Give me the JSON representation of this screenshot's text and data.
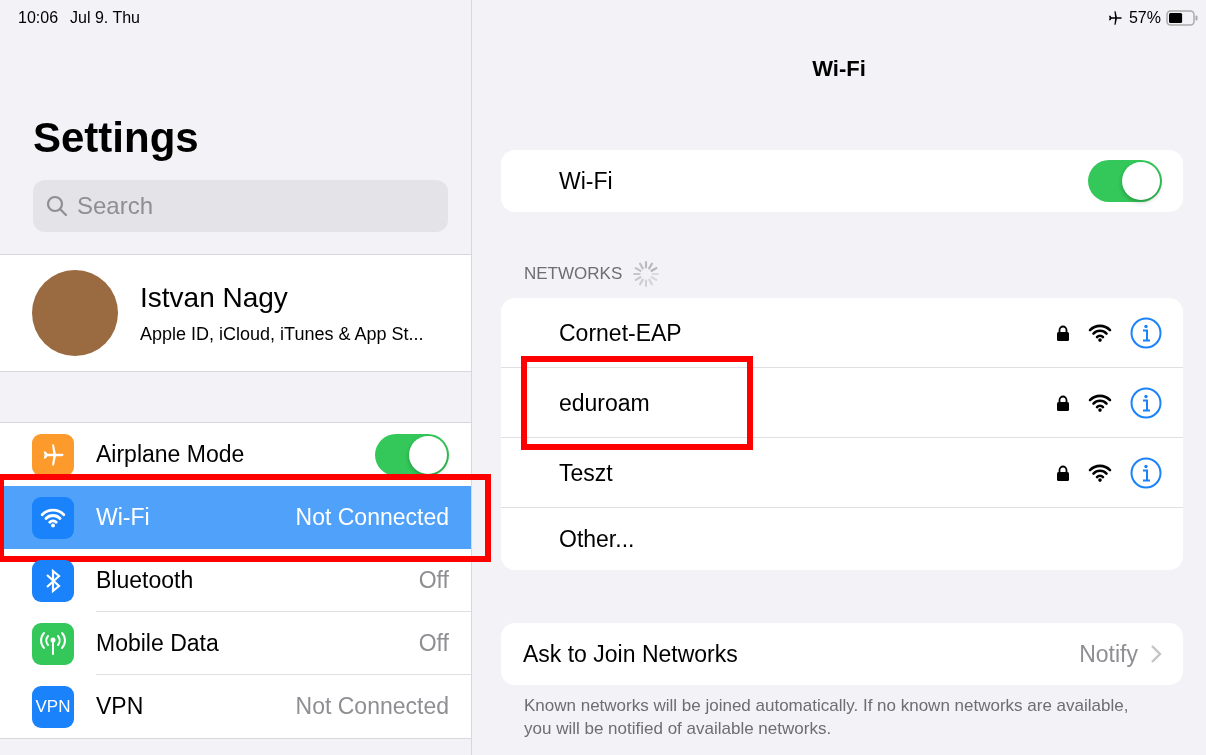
{
  "status_bar": {
    "time": "10:06",
    "date": "Jul 9. Thu",
    "battery_text": "57%",
    "battery": {
      "level": 0.57
    }
  },
  "sidebar": {
    "title": "Settings",
    "search": {
      "placeholder": "Search"
    },
    "profile": {
      "name": "Istvan Nagy",
      "subtitle": "Apple ID, iCloud, iTunes & App St..."
    },
    "items": [
      {
        "kind": "toggle",
        "label": "Airplane Mode",
        "on": true,
        "selected": false,
        "highlighted": false
      },
      {
        "kind": "value",
        "label": "Wi-Fi",
        "value": "Not Connected",
        "selected": true,
        "highlighted": true
      },
      {
        "kind": "value",
        "label": "Bluetooth",
        "value": "Off",
        "selected": false,
        "highlighted": false
      },
      {
        "kind": "value",
        "label": "Mobile Data",
        "value": "Off",
        "selected": false,
        "highlighted": false
      },
      {
        "kind": "value",
        "icon_text": "VPN",
        "label": "VPN",
        "value": "Not Connected",
        "selected": false,
        "highlighted": false
      }
    ]
  },
  "detail": {
    "title": "Wi-Fi",
    "wifi_toggle": {
      "label": "Wi-Fi",
      "on": true
    },
    "networks_header": "NETWORKS",
    "networks": [
      {
        "kind": "network",
        "name": "Cornet-EAP",
        "highlighted": false
      },
      {
        "kind": "network",
        "name": "eduroam",
        "highlighted": true
      },
      {
        "kind": "network",
        "name": "Teszt",
        "highlighted": false
      },
      {
        "kind": "other",
        "name": "Other...",
        "highlighted": false
      }
    ],
    "ask_to_join": {
      "label": "Ask to Join Networks",
      "value": "Notify"
    },
    "footer": "Known networks will be joined automatically. If no known networks are available, you will be notified of available networks."
  }
}
